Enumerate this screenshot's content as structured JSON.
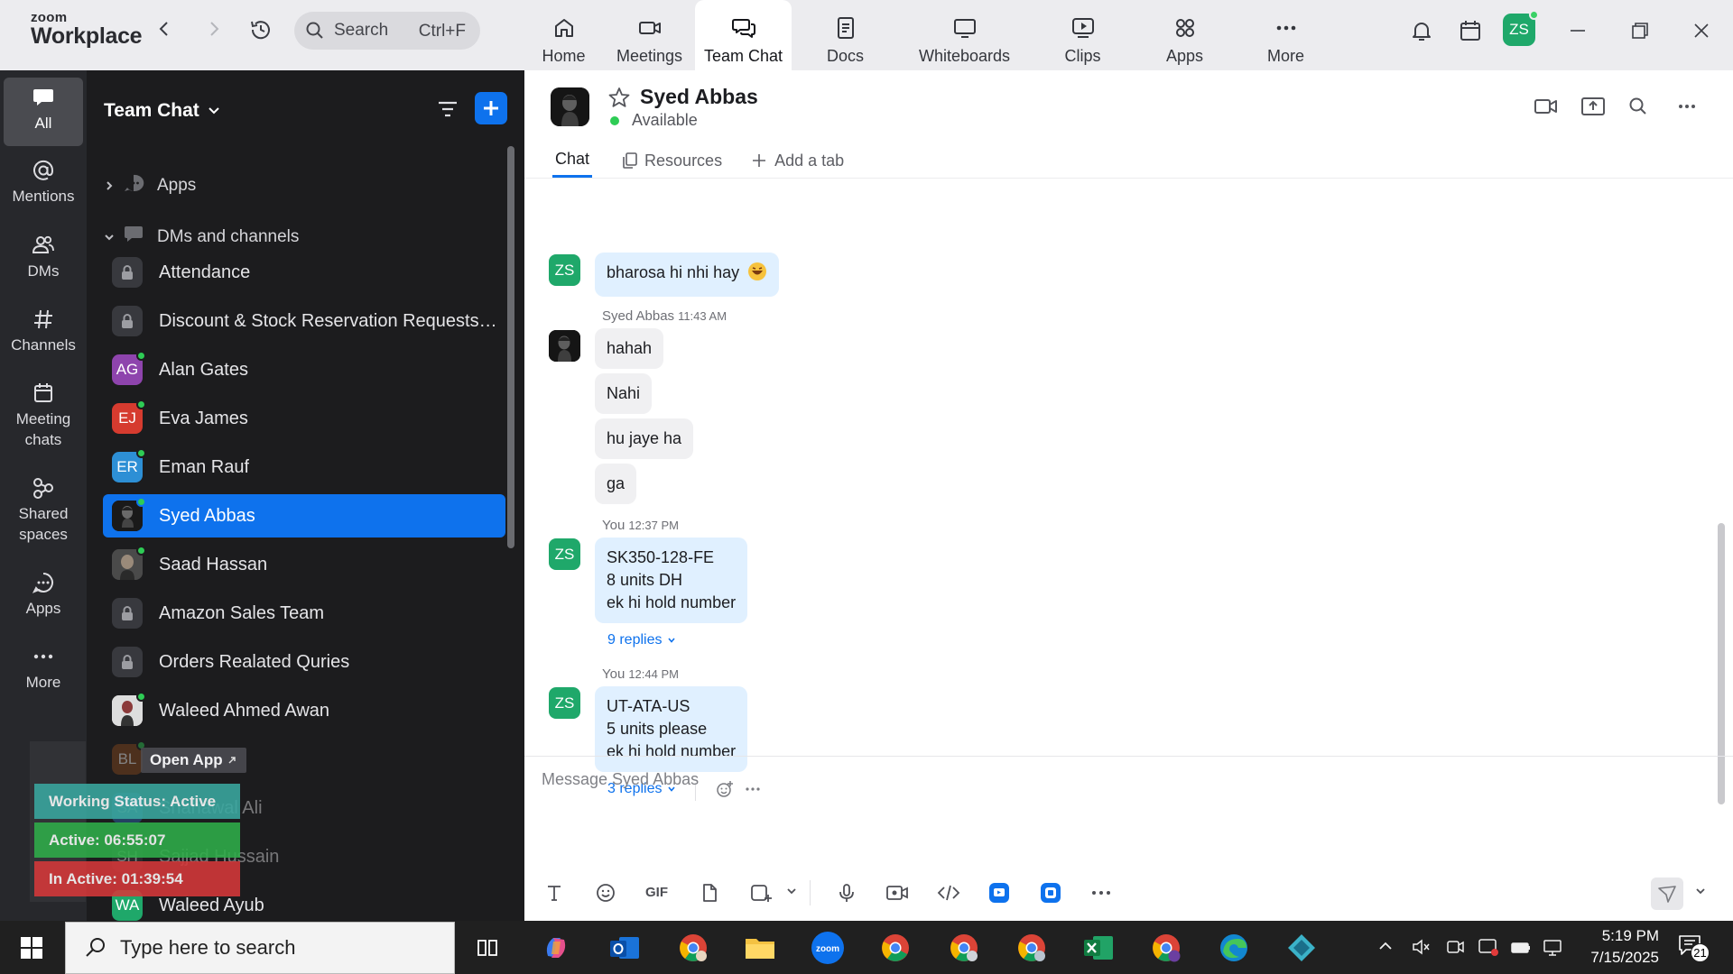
{
  "app": {
    "logo_top": "zoom",
    "logo_bottom": "Workplace",
    "search_placeholder": "Search",
    "search_shortcut": "Ctrl+F",
    "user_initials": "ZS",
    "nav": [
      {
        "label": "Home",
        "icon": "home-icon"
      },
      {
        "label": "Meetings",
        "icon": "video-camera-icon"
      },
      {
        "label": "Team Chat",
        "icon": "chat-icon",
        "active": true
      },
      {
        "label": "Docs",
        "icon": "document-icon"
      },
      {
        "label": "Whiteboards",
        "icon": "whiteboard-icon"
      },
      {
        "label": "Clips",
        "icon": "clips-icon"
      },
      {
        "label": "Apps",
        "icon": "apps-icon"
      },
      {
        "label": "More",
        "icon": "more-icon"
      }
    ]
  },
  "rail": [
    {
      "label": "All"
    },
    {
      "label": "Mentions"
    },
    {
      "label": "DMs"
    },
    {
      "label": "Channels"
    },
    {
      "label": "Meeting chats"
    },
    {
      "label": "Shared spaces"
    },
    {
      "label": "Apps"
    },
    {
      "label": "More"
    }
  ],
  "list": {
    "title": "Team Chat",
    "sections": [
      {
        "label": "Apps"
      },
      {
        "label": "DMs and channels"
      }
    ],
    "items": [
      {
        "name": "Attendance",
        "kind": "lock"
      },
      {
        "name": "Discount & Stock Reservation Requests O...",
        "kind": "lock"
      },
      {
        "name": "Alan Gates",
        "initials": "AG",
        "color": "#8e44ad",
        "online": true
      },
      {
        "name": "Eva James",
        "initials": "EJ",
        "color": "#d63b2f",
        "online": true
      },
      {
        "name": "Eman Rauf",
        "initials": "ER",
        "color": "#2d8fd5",
        "online": true
      },
      {
        "name": "Syed Abbas",
        "kind": "photo",
        "online": true,
        "selected": true
      },
      {
        "name": "Saad Hassan",
        "kind": "photo",
        "online": true
      },
      {
        "name": "Amazon Sales Team",
        "kind": "lock"
      },
      {
        "name": "Orders Realated Quries",
        "kind": "lock"
      },
      {
        "name": "Waleed Ahmed Awan",
        "kind": "photo",
        "online": true
      },
      {
        "name": "",
        "initials": "BL",
        "color": "#8a4a1c",
        "online": true
      },
      {
        "name": "Shahawal Ali",
        "initials": "SA",
        "color": "#2d6fb5",
        "online": false
      },
      {
        "name": "Sajjad Hussain",
        "initials": "SH",
        "color": "#3a3a3f",
        "online": false
      },
      {
        "name": "Waleed Ayub",
        "initials": "WA",
        "color": "#1fa86a",
        "online": false
      }
    ],
    "overlay": {
      "open_app": "Open App",
      "working_status": "Working Status: Active",
      "active": "Active: 06:55:07",
      "inactive": "In Active: 01:39:54",
      "colors": {
        "working": "#3aa8a0",
        "active": "#2fae4a",
        "inactive": "#d6383a"
      }
    }
  },
  "chat": {
    "contact_name": "Syed Abbas",
    "status": "Available",
    "tabs": [
      "Chat",
      "Resources",
      "Add a tab"
    ],
    "messages": {
      "m0": {
        "text": "bharosa hi nhi hay"
      },
      "g1_sender": "Syed Abbas",
      "g1_time": "11:43 AM",
      "g1_lines": [
        "hahah",
        "Nahi",
        "hu jaye ha",
        "ga"
      ],
      "g2_sender": "You",
      "g2_time": "12:37 PM",
      "g2_lines": [
        "SK350-128-FE",
        "8 units DH",
        "ek hi hold number"
      ],
      "g2_replies": "9 replies",
      "g3_sender": "You",
      "g3_time": "12:44 PM",
      "g3_lines": [
        "UT-ATA-US",
        "5 units please",
        "ek hi hold number"
      ],
      "g3_replies": "3 replies"
    },
    "composer_placeholder": "Message Syed Abbas",
    "toolbar": [
      "text-format-icon",
      "emoji-icon",
      "gif-icon",
      "file-icon",
      "screenshot-icon",
      "dropdown-icon",
      "microphone-icon",
      "video-message-icon",
      "code-icon",
      "app-icon",
      "app-icon-2",
      "more-icon"
    ],
    "gif_label": "GIF",
    "accent": "#0e72ed"
  },
  "taskbar": {
    "search_placeholder": "Type here to search",
    "time": "5:19 PM",
    "date": "7/15/2025",
    "notif_count": "21"
  }
}
